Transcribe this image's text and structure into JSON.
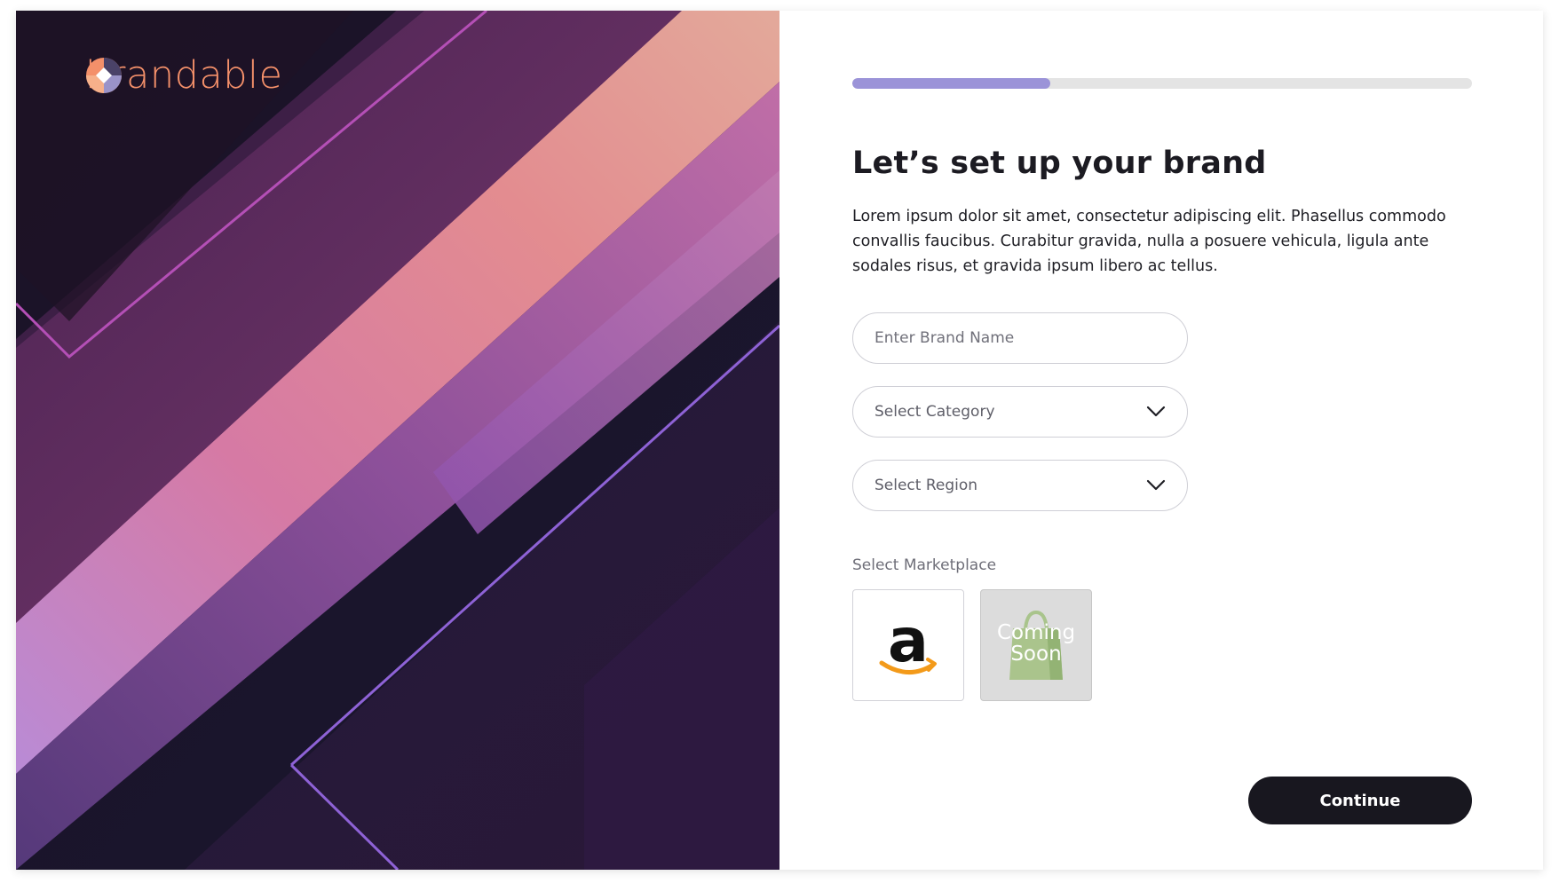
{
  "brand": {
    "logo_text": "brandable",
    "accent_color": "#f4906a"
  },
  "progress": {
    "fraction": 0.32,
    "fill_color": "#9b93d8"
  },
  "heading": "Let’s set up your brand",
  "description": "Lorem ipsum dolor sit amet, consectetur adipiscing elit. Phasellus commodo convallis faucibus. Curabitur gravida, nulla a posuere vehicula, ligula ante sodales risus, et gravida ipsum libero ac tellus.",
  "form": {
    "brand_name_placeholder": "Enter Brand Name",
    "category_placeholder": "Select Category",
    "region_placeholder": "Select Region",
    "marketplace_label": "Select Marketplace",
    "marketplaces": [
      {
        "name": "amazon",
        "icon": "amazon-logo-icon",
        "enabled": true
      },
      {
        "name": "shopify",
        "icon": "shopify-bag-icon",
        "enabled": false,
        "badge": "Coming Soon"
      }
    ]
  },
  "continue_label": "Continue",
  "colors": {
    "button_bg": "#18171f",
    "text_primary": "#1c1b22"
  }
}
